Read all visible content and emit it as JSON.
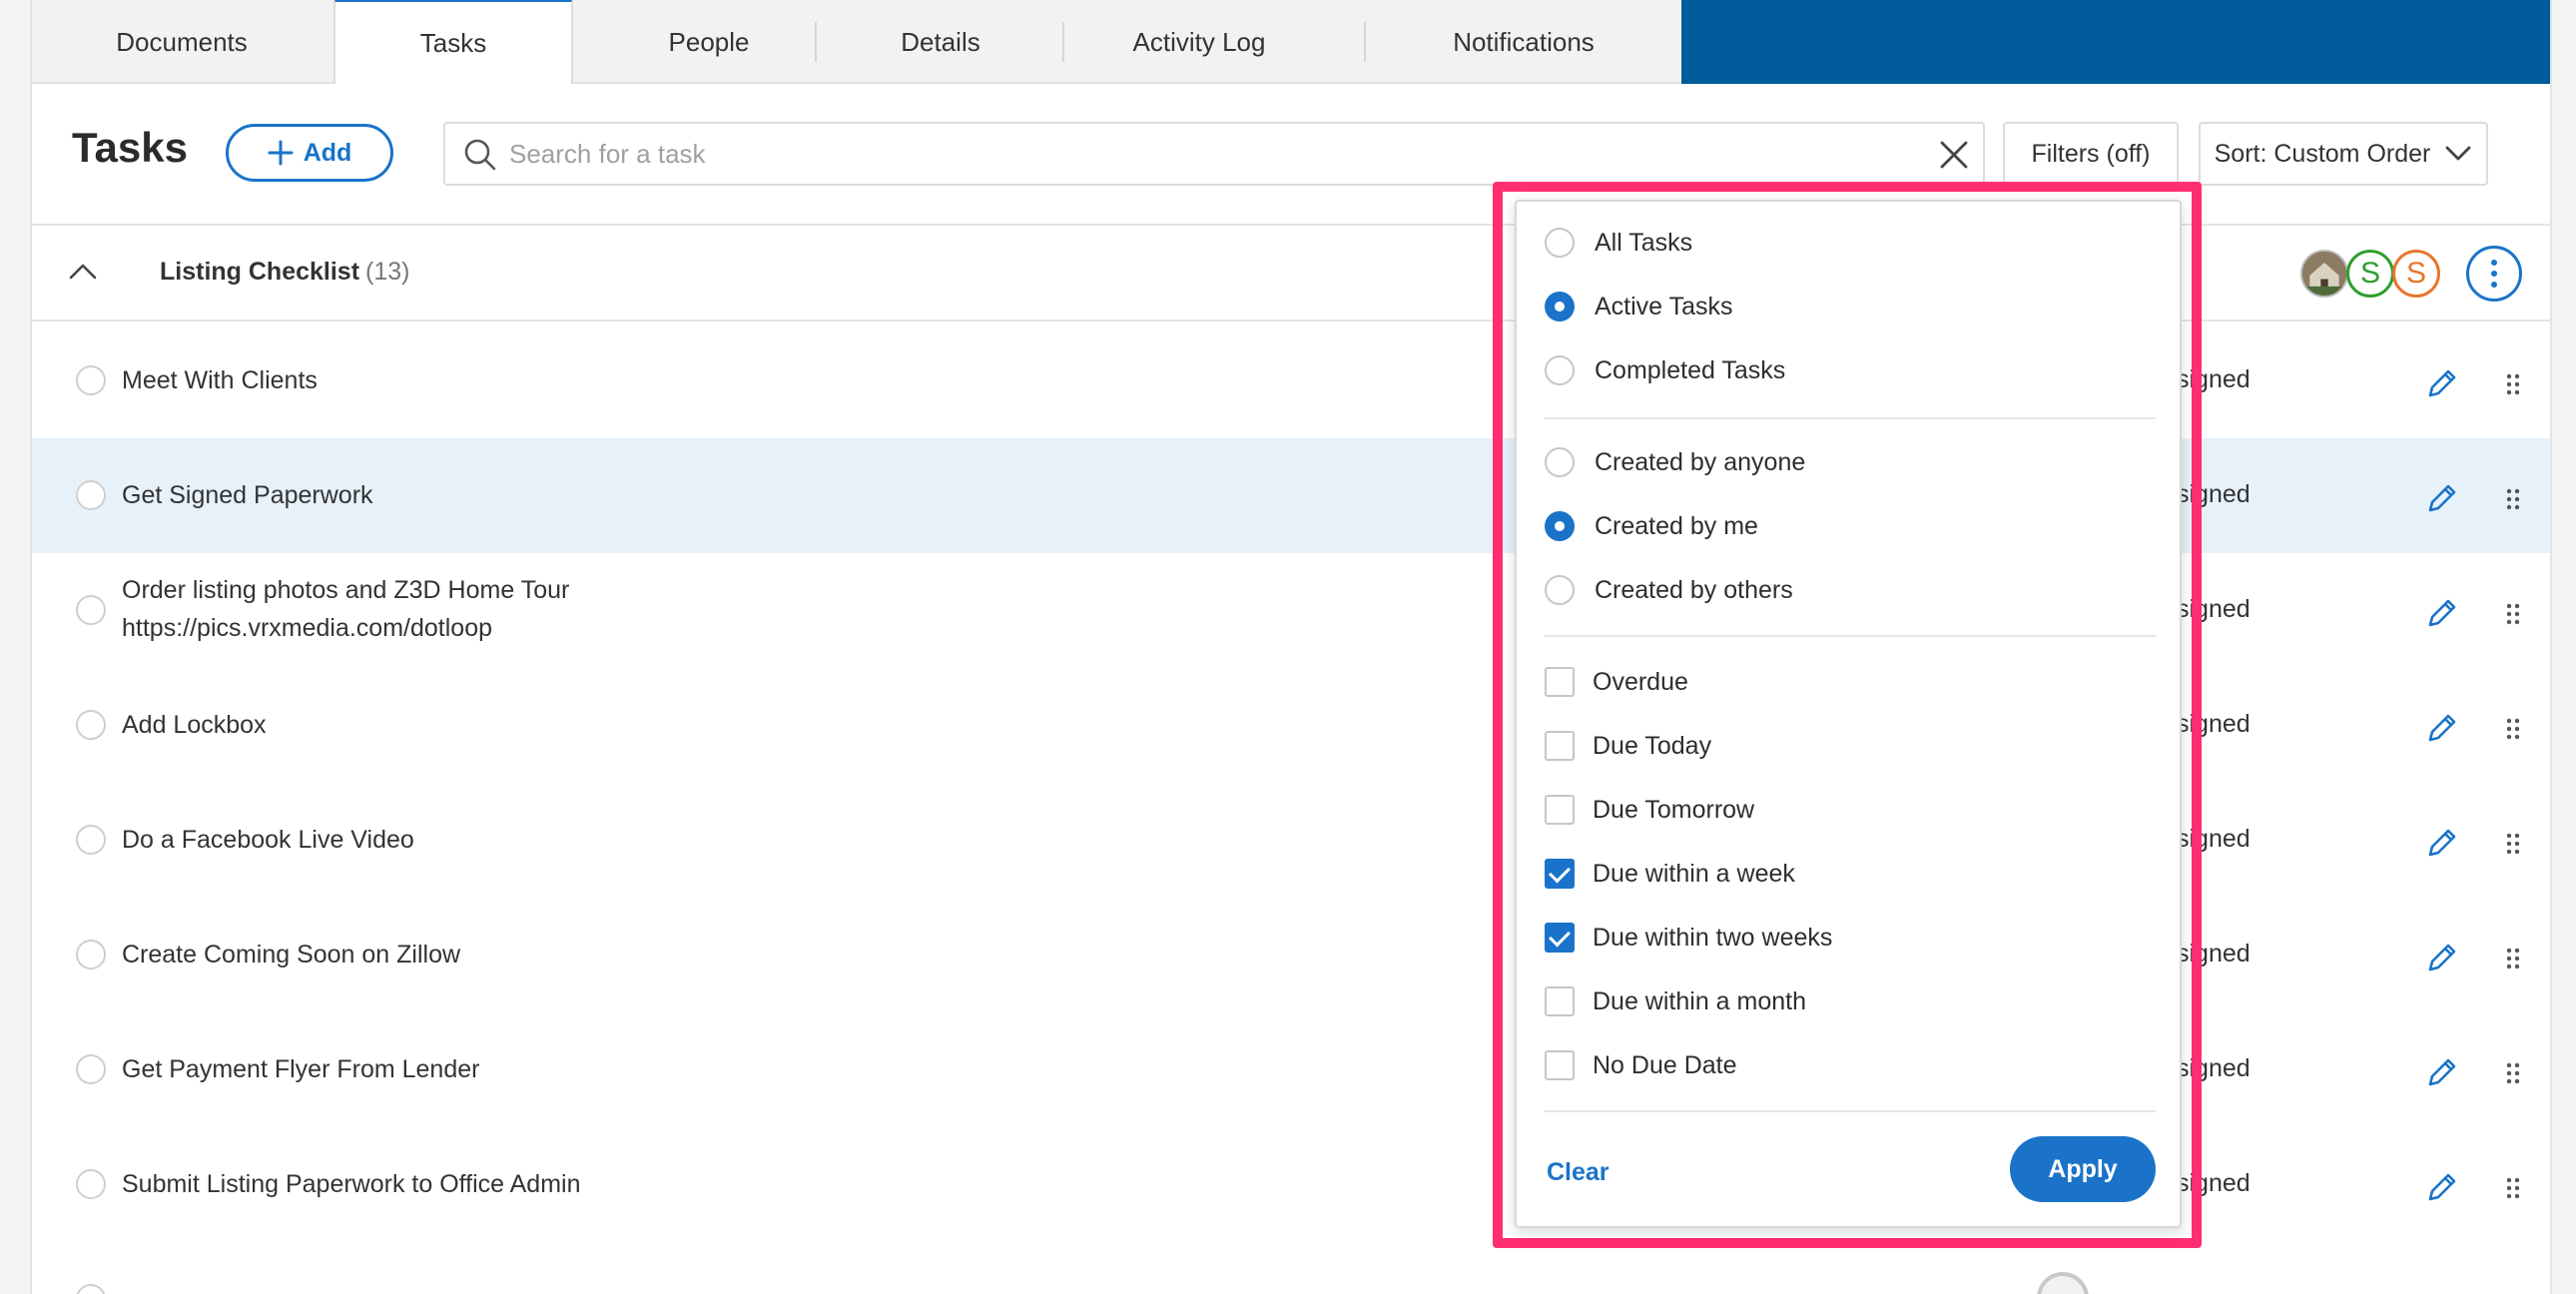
{
  "tabs": [
    {
      "label": "Documents"
    },
    {
      "label": "Tasks"
    },
    {
      "label": "People"
    },
    {
      "label": "Details"
    },
    {
      "label": "Activity Log"
    },
    {
      "label": "Notifications"
    }
  ],
  "active_tab": "Tasks",
  "header": {
    "title": "Tasks",
    "add_label": "Add",
    "search_placeholder": "Search for a task",
    "filters_label": "Filters (off)",
    "sort_label": "Sort: Custom Order"
  },
  "section": {
    "title": "Listing Checklist",
    "count": "(13)",
    "avatars": [
      {
        "type": "photo"
      },
      {
        "letter": "S",
        "color": "#2e9e2e"
      },
      {
        "letter": "S",
        "color": "#e8762c"
      }
    ]
  },
  "tasks": [
    {
      "name": "Meet With Clients",
      "assignee": "signed"
    },
    {
      "name": "Get Signed Paperwork",
      "assignee": "signed"
    },
    {
      "name": "Order listing photos and Z3D Home Tour",
      "name_line2": "https://pics.vrxmedia.com/dotloop",
      "assignee": "signed"
    },
    {
      "name": "Add Lockbox",
      "assignee": "signed"
    },
    {
      "name": "Do a Facebook Live Video",
      "assignee": "signed"
    },
    {
      "name": "Create Coming Soon on Zillow",
      "assignee": "signed"
    },
    {
      "name": "Get Payment Flyer From Lender",
      "assignee": "signed"
    },
    {
      "name": "Submit Listing Paperwork to Office Admin",
      "assignee": "signed"
    }
  ],
  "filter_panel": {
    "status_options": [
      {
        "label": "All Tasks",
        "selected": false
      },
      {
        "label": "Active Tasks",
        "selected": true
      },
      {
        "label": "Completed Tasks",
        "selected": false
      }
    ],
    "creator_options": [
      {
        "label": "Created by anyone",
        "selected": false
      },
      {
        "label": "Created by me",
        "selected": true
      },
      {
        "label": "Created by others",
        "selected": false
      }
    ],
    "due_options": [
      {
        "label": "Overdue",
        "checked": false
      },
      {
        "label": "Due Today",
        "checked": false
      },
      {
        "label": "Due Tomorrow",
        "checked": false
      },
      {
        "label": "Due within a week",
        "checked": true
      },
      {
        "label": "Due within two weeks",
        "checked": true
      },
      {
        "label": "Due within a month",
        "checked": false
      },
      {
        "label": "No Due Date",
        "checked": false
      }
    ],
    "clear_label": "Clear",
    "apply_label": "Apply"
  },
  "colors": {
    "accent": "#1a73c9",
    "topbar": "#005b9a",
    "highlight": "#ff2e70",
    "row_highlight": "#e6f1fa"
  }
}
